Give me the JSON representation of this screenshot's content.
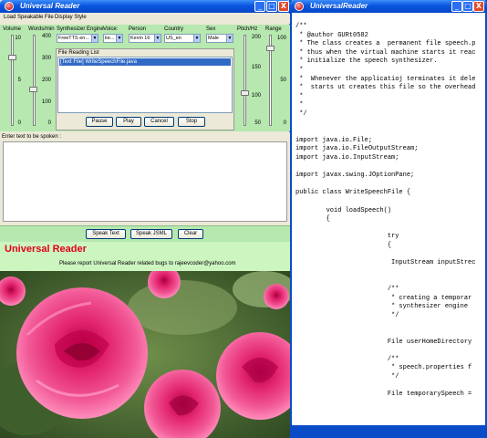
{
  "left_window": {
    "title": "Universal Reader",
    "buttons": {
      "minimize": "_",
      "maximize": "□",
      "close": "X"
    },
    "menu": [
      "Load Speakable File",
      "Display Style"
    ],
    "labels": {
      "volume": "Volume",
      "words_per_min": "Words/min",
      "engine": "Synthesizer Engine",
      "voice": "Voice:",
      "person": "Person",
      "country": "Country",
      "sex": "Sex",
      "pitch": "Pitch/Hz",
      "range": "Range"
    },
    "volume_scale": [
      "10",
      "5",
      "0"
    ],
    "volume_level": 0.75,
    "wpm_scale": [
      "400",
      "300",
      "200",
      "100",
      "0"
    ],
    "wpm_level": 0.4,
    "pitch_scale": [
      "200",
      "150",
      "100",
      "50"
    ],
    "pitch_level": 0.36,
    "range_scale": [
      "100",
      "50",
      "0"
    ],
    "range_level": 0.85,
    "selects": {
      "engine": "FreeTTS en...",
      "voice": "ke...",
      "person": "Kevin 16",
      "country": "US_en",
      "sex": "Male"
    },
    "reading_list": {
      "title": "File Reading List",
      "items": [
        "[Text File] WriteSpeechFile.java"
      ]
    },
    "reading_buttons": [
      "Pause",
      "Play",
      "Cancel",
      "Stop"
    ],
    "text_label": "Enter text  to be spoken :",
    "speak_buttons": [
      "Speak Text",
      "Speak JSML",
      "Clear"
    ],
    "banner_title": "Universal Reader",
    "banner_text": "Please report Universal Reader related bugs to rajeevcoder@yahoo.com",
    "colors": {
      "panel_green": "#b6e8b0",
      "banner_green": "#ccf5c0",
      "title_red": "#e2001a",
      "selection_blue": "#316ac5"
    }
  },
  "right_window": {
    "title": "UniversalReader",
    "buttons": {
      "minimize": "_",
      "maximize": "□",
      "close": "X"
    },
    "code_lines": [
      "/**",
      " * @author GURt0582",
      " * The class creates a  permanent file speech.p",
      " * thus when the virtual machine starts it reac",
      " * initialize the speech synthesizer.",
      " *",
      " *  Whenever the applicatioj terminates it dele",
      " *  starts ut creates this file so the overhead",
      " *",
      " *",
      " */",
      "",
      "",
      "import java.io.File;",
      "import java.io.FileOutputStream;",
      "import java.io.InputStream;",
      "",
      "import javax.swing.JOptionPane;",
      "",
      "public class WriteSpeechFile {",
      "",
      "        void loadSpeech()",
      "        {",
      "",
      "                        try",
      "                        {",
      "",
      "                         InputStream inputStrec",
      "",
      "",
      "                        /**",
      "                         * creating a temporar",
      "                         * synthesizer engine",
      "                         */",
      "",
      "",
      "                        File userHomeDirectory",
      "",
      "                        /**",
      "                         * speech.properties f",
      "                         */",
      "",
      "                        File temporarySpeech ="
    ]
  }
}
